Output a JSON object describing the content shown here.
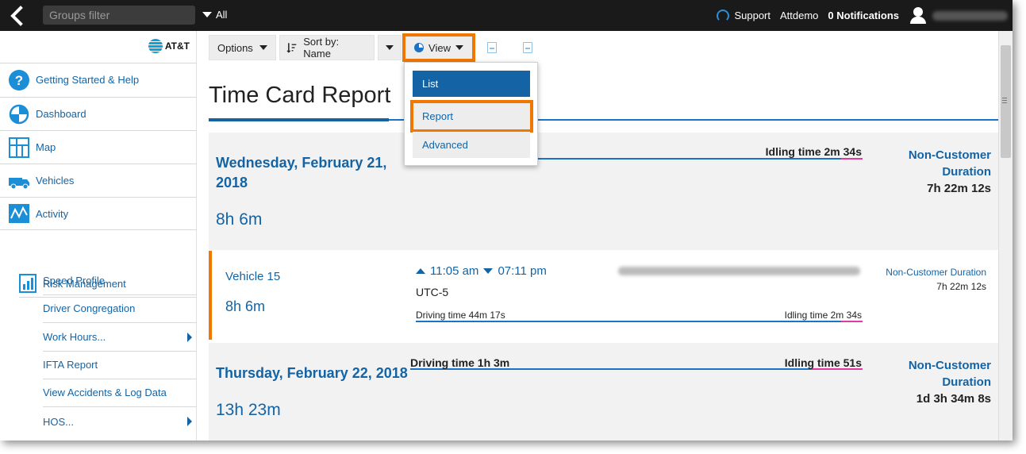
{
  "topbar": {
    "groups_filter_placeholder": "Groups filter",
    "groups_scope": "All",
    "support": "Support",
    "account": "Attdemo",
    "notifications": "0 Notifications"
  },
  "brand": "AT&T",
  "sidebar": {
    "items": [
      {
        "label": "Getting Started & Help",
        "icon": "help-icon"
      },
      {
        "label": "Dashboard",
        "icon": "dashboard-icon"
      },
      {
        "label": "Map",
        "icon": "map-icon"
      },
      {
        "label": "Vehicles",
        "icon": "vehicle-icon"
      },
      {
        "label": "Activity",
        "icon": "activity-icon"
      }
    ],
    "risk_management": "Risk Management",
    "sub_items": [
      {
        "label": "Speed Profile",
        "has_submenu": false
      },
      {
        "label": "Driver Congregation",
        "has_submenu": false
      },
      {
        "label": "Work Hours...",
        "has_submenu": true
      },
      {
        "label": "IFTA Report",
        "has_submenu": false
      },
      {
        "label": "View Accidents & Log Data",
        "has_submenu": false
      },
      {
        "label": "HOS...",
        "has_submenu": true
      }
    ]
  },
  "toolbar": {
    "options": "Options",
    "sort": "Sort by: Name",
    "view": "View"
  },
  "view_menu": {
    "list": "List",
    "report": "Report",
    "advanced": "Advanced"
  },
  "page_title": "Time Card Report",
  "days": [
    {
      "date": "Wednesday, February 21, 2018",
      "total": "8h 6m",
      "driving": "",
      "idling": "Idling time 2m 34s",
      "nc_title": "Non-Customer Duration",
      "nc_value": "7h 22m 12s"
    },
    {
      "date": "Thursday, February 22, 2018",
      "total": "13h 23m",
      "driving": "Driving time 1h 3m",
      "idling": "Idling time 51s",
      "nc_title": "Non-Customer Duration",
      "nc_value": "1d 3h 34m 8s"
    }
  ],
  "vehicle_row": {
    "name": "Vehicle 15",
    "duration": "8h 6m",
    "start": "11:05 am",
    "end": "07:11 pm",
    "timezone": "UTC-5",
    "driving": "Driving time 44m 17s",
    "idling": "Idling time 2m 34s",
    "nc_title": "Non-Customer Duration",
    "nc_value": "7h 22m 12s"
  },
  "colors": {
    "accent": "#1464a5",
    "highlight": "#f07800",
    "idle_line": "#e03ca0"
  }
}
